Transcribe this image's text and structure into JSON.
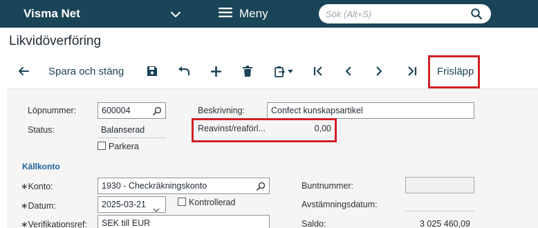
{
  "topbar": {
    "brand": "Visma Net",
    "menu_label": "Meny",
    "search_placeholder": "Sök (Alt+S)"
  },
  "page": {
    "title": "Likvidöverföring"
  },
  "toolbar": {
    "save_close_label": "Spara och stäng",
    "release_label": "Frisläpp"
  },
  "form": {
    "lopnummer_label": "Löpnummer:",
    "lopnummer_value": "600004",
    "status_label": "Status:",
    "status_value": "Balanserad",
    "parkera_label": "Parkera",
    "beskrivning_label": "Beskrivning:",
    "beskrivning_value": "Confect kunskapsartikel",
    "reavinst_label": "Reavinst/reaförl...",
    "reavinst_value": "0,00",
    "kallkonto_header": "Källkonto",
    "konto_label": "Konto:",
    "konto_value": "1930 - Checkräkningskonto",
    "datum_label": "Datum:",
    "datum_value": "2025-03-21",
    "kontrollerad_label": "Kontrollerad",
    "verifikationsref_label": "Verifikationsref:",
    "verifikationsref_value": "SEK till EUR",
    "buntnummer_label": "Buntnummer:",
    "buntnummer_value": "",
    "avstamningsdatum_label": "Avstämningsdatum:",
    "avstamningsdatum_value": "",
    "saldo_label": "Saldo:",
    "saldo_value": "3 025 460,09"
  }
}
